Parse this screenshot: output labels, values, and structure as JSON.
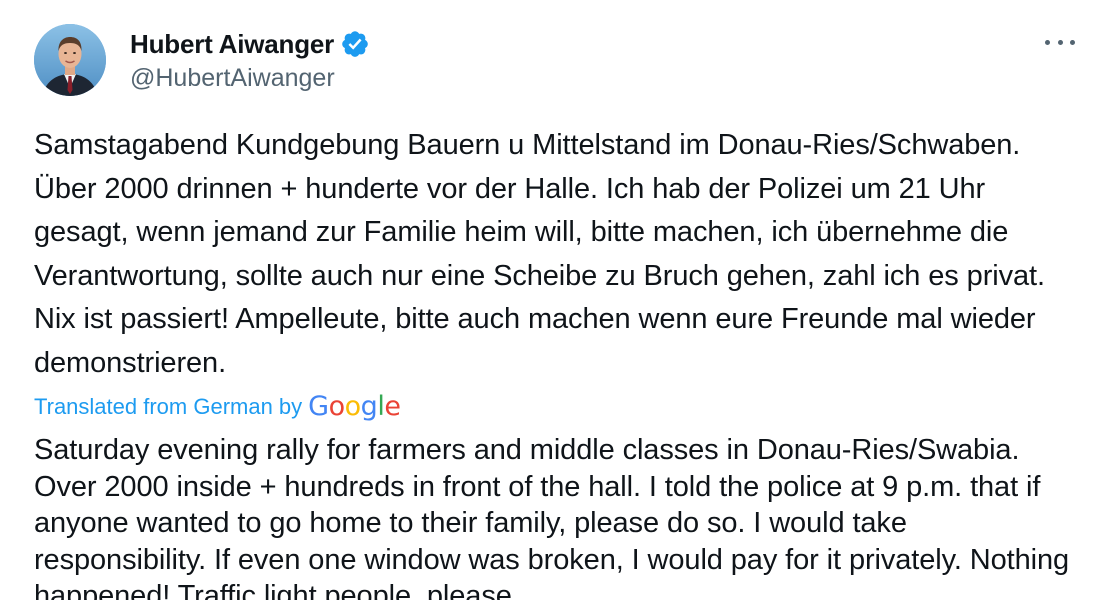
{
  "author": {
    "display_name": "Hubert Aiwanger",
    "handle": "@HubertAiwanger",
    "verified": true,
    "verified_color": "#1d9bf0",
    "avatar_icon": "person-photo-avatar"
  },
  "menu": {
    "icon": "more-horizontal-icon"
  },
  "tweet": {
    "original_text": "Samstagabend Kundgebung Bauern u Mittelstand im Donau-Ries/Schwaben. Über 2000 drinnen + hunderte vor der Halle. Ich hab der Polizei um 21 Uhr gesagt, wenn jemand zur Familie heim will, bitte machen, ich übernehme die Verantwortung, sollte auch nur eine Scheibe zu Bruch gehen, zahl ich es privat. Nix ist passiert! Ampelleute, bitte auch machen wenn eure Freunde mal wieder demonstrieren.",
    "translation_label": "Translated from German by",
    "translation_provider": {
      "G": "G",
      "o1": "o",
      "o2": "o",
      "g": "g",
      "l": "l",
      "e": "e"
    },
    "translated_text": "Saturday evening rally for farmers and middle classes in Donau-Ries/Swabia. Over 2000 inside + hundreds in front of the hall. I told the police at 9 p.m. that if anyone wanted to go home to their family, please do so. I would take responsibility. If even one window was broken, I would pay for it privately. Nothing happened! Traffic light people, please"
  },
  "colors": {
    "link_blue": "#1d9bf0",
    "secondary_text": "#536471",
    "primary_text": "#0f1419"
  }
}
